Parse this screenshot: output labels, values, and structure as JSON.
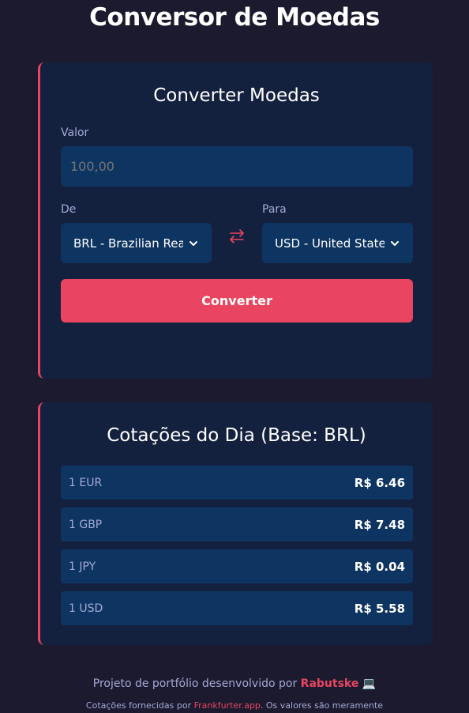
{
  "header": {
    "title": "Conversor de Moedas"
  },
  "converter": {
    "title": "Converter Moedas",
    "amount_label": "Valor",
    "amount_placeholder": "100,00",
    "from_label": "De",
    "from_value": "BRL - Brazilian Real",
    "to_label": "Para",
    "to_value": "USD - United States Dollar",
    "convert_label": "Converter"
  },
  "rates": {
    "title": "Cotações do Dia (Base: BRL)",
    "items": [
      {
        "currency": "1 EUR",
        "value": "R$ 6.46"
      },
      {
        "currency": "1 GBP",
        "value": "R$ 7.48"
      },
      {
        "currency": "1 JPY",
        "value": "R$ 0.04"
      },
      {
        "currency": "1 USD",
        "value": "R$ 5.58"
      }
    ]
  },
  "footer": {
    "line1_prefix": "Projeto de portfólio desenvolvido por",
    "author": "Rabutske",
    "laptop_emoji": "💻",
    "line2_prefix": "Cotações fornecidas por",
    "source": "Frankfurter.app",
    "line2_suffix": ". Os valores são meramente"
  },
  "colors": {
    "background": "#1b1a2e",
    "card": "#14213e",
    "field": "#0e3461",
    "accent": "#e94560",
    "muted_text": "#a5a9d6"
  },
  "icons": {
    "swap": "swap-arrows-icon",
    "select_chevron": "chevron-down-icon",
    "laptop": "laptop-icon"
  }
}
